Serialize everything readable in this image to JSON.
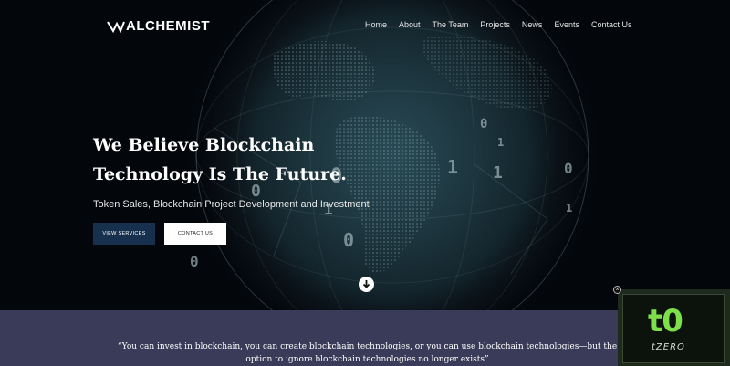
{
  "brand": {
    "name": "ALCHEMIST"
  },
  "nav": {
    "items": [
      "Home",
      "About",
      "The Team",
      "Projects",
      "News",
      "Events",
      "Contact Us"
    ]
  },
  "hero": {
    "headline_line1": "We Believe Blockchain",
    "headline_line2": "Technology Is The Future.",
    "subheadline": "Token Sales, Blockchain Project Development and Investment",
    "primary_button": "VIEW SERVICES",
    "secondary_button": "CONTACT US",
    "background_digits": [
      "0",
      "1",
      "0",
      "1",
      "0",
      "1",
      "0",
      "0",
      "1",
      "0",
      "1"
    ]
  },
  "quote": {
    "line1": "“You can invest in blockchain, you can create blockchain technologies, or you can use blockchain technologies—but the",
    "line2": "option to ignore blockchain technologies no longer exists”"
  },
  "widget": {
    "logo_text": "t0",
    "brand_text": "tZERO"
  },
  "colors": {
    "primary_button_bg": "#16304d",
    "quote_section_bg": "#3a3b59",
    "widget_accent": "#7de04a"
  },
  "icons": [
    "alchemist-logo-icon",
    "chevron-down-icon",
    "close-icon"
  ]
}
